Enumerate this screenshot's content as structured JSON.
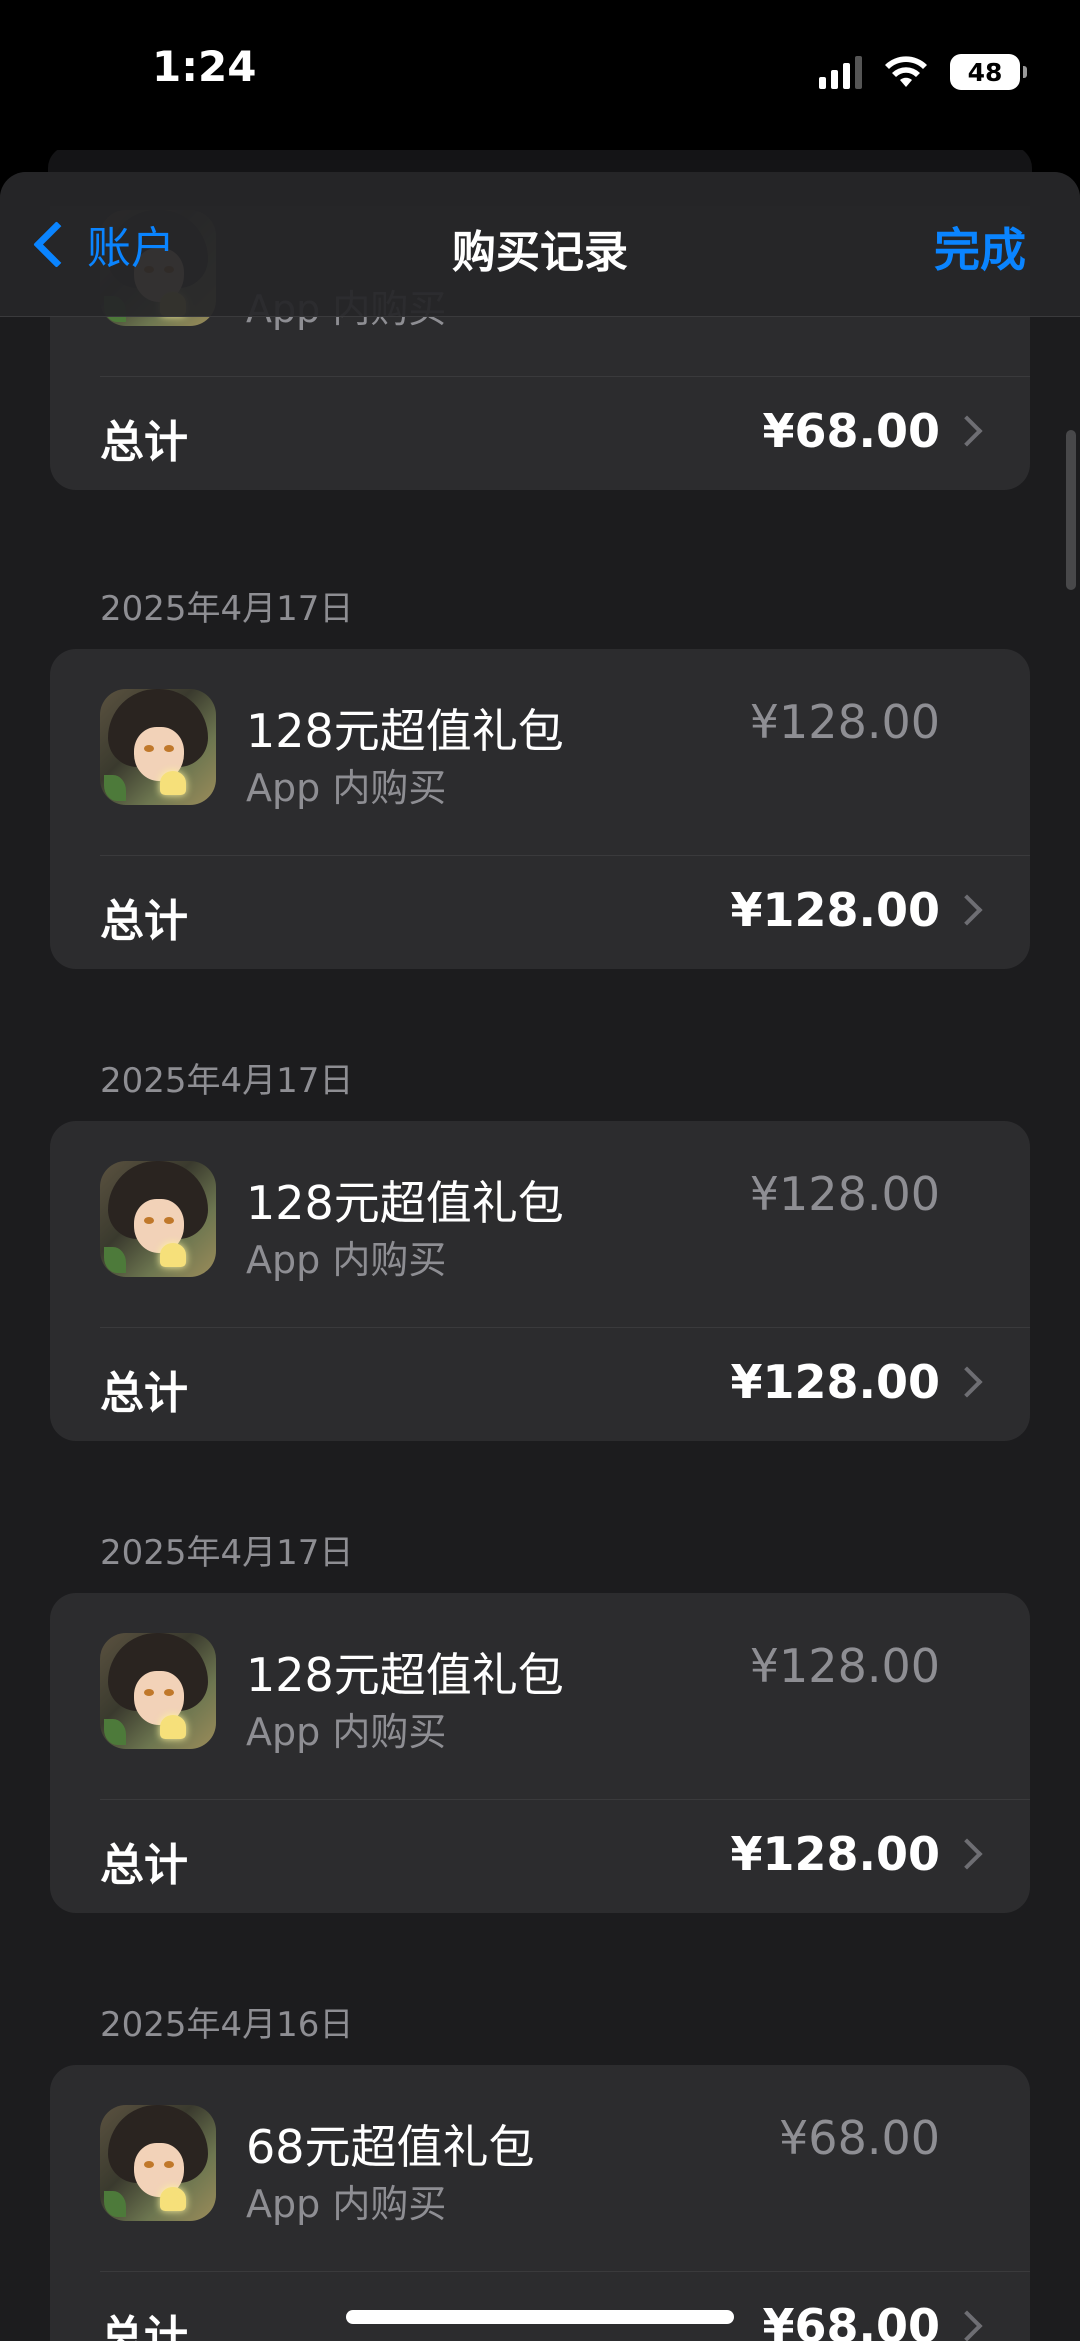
{
  "status_bar": {
    "time": "1:24",
    "battery": "48"
  },
  "nav": {
    "back_label": "账户",
    "title": "购买记录",
    "done_label": "完成"
  },
  "purchases": [
    {
      "date": "",
      "item_name": "",
      "item_sub": "App 内购买",
      "item_price": "",
      "total_label": "总计",
      "total_value": "¥68.00"
    },
    {
      "date": "2025年4月17日",
      "item_name": "128元超值礼包",
      "item_sub": "App 内购买",
      "item_price": "¥128.00",
      "total_label": "总计",
      "total_value": "¥128.00"
    },
    {
      "date": "2025年4月17日",
      "item_name": "128元超值礼包",
      "item_sub": "App 内购买",
      "item_price": "¥128.00",
      "total_label": "总计",
      "total_value": "¥128.00"
    },
    {
      "date": "2025年4月17日",
      "item_name": "128元超值礼包",
      "item_sub": "App 内购买",
      "item_price": "¥128.00",
      "total_label": "总计",
      "total_value": "¥128.00"
    },
    {
      "date": "2025年4月16日",
      "item_name": "68元超值礼包",
      "item_sub": "App 内购买",
      "item_price": "¥68.00",
      "total_label": "总计",
      "total_value": "¥68.00"
    }
  ],
  "colors": {
    "accent": "#0a84ff",
    "background": "#1c1c1e",
    "card": "#2c2c2e",
    "secondary_text": "#8e8e93"
  }
}
